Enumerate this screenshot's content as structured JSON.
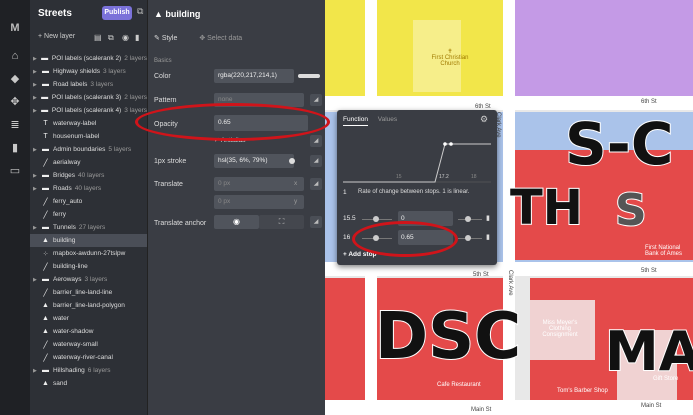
{
  "rail": [
    "M",
    "⌂",
    "◆",
    "✥",
    "≣",
    "▮",
    "▭"
  ],
  "layers_panel": {
    "title": "Streets",
    "publish": "Publish",
    "new_layer": "+ New layer",
    "items": [
      {
        "label": "POI labels (scalerank 2)",
        "count": "2 layers",
        "icon": "folder",
        "arrow": true
      },
      {
        "label": "Highway shields",
        "count": "3 layers",
        "icon": "folder",
        "arrow": true
      },
      {
        "label": "Road labels",
        "count": "3 layers",
        "icon": "folder",
        "arrow": true
      },
      {
        "label": "POI labels (scalerank 3)",
        "count": "2 layers",
        "icon": "folder",
        "arrow": true
      },
      {
        "label": "POI labels (scalerank 4)",
        "count": "3 layers",
        "icon": "folder",
        "arrow": true
      },
      {
        "label": "waterway-label",
        "count": "",
        "icon": "T",
        "arrow": false
      },
      {
        "label": "housenum-label",
        "count": "",
        "icon": "T",
        "arrow": false
      },
      {
        "label": "Admin boundaries",
        "count": "5 layers",
        "icon": "folder",
        "arrow": true
      },
      {
        "label": "aerialway",
        "count": "",
        "icon": "line",
        "arrow": false
      },
      {
        "label": "Bridges",
        "count": "40 layers",
        "icon": "folder",
        "arrow": true
      },
      {
        "label": "Roads",
        "count": "40 layers",
        "icon": "folder",
        "arrow": true
      },
      {
        "label": "ferry_auto",
        "count": "",
        "icon": "line",
        "arrow": false
      },
      {
        "label": "ferry",
        "count": "",
        "icon": "line",
        "arrow": false
      },
      {
        "label": "Tunnels",
        "count": "27 layers",
        "icon": "folder",
        "arrow": true
      },
      {
        "label": "building",
        "count": "",
        "icon": "fill",
        "arrow": false,
        "selected": true
      },
      {
        "label": "mapbox-awdunn-27tslpw",
        "count": "",
        "icon": "dots",
        "arrow": false
      },
      {
        "label": "building-line",
        "count": "",
        "icon": "line",
        "arrow": false
      },
      {
        "label": "Aeroways",
        "count": "3 layers",
        "icon": "folder",
        "arrow": true
      },
      {
        "label": "barrier_line-land-line",
        "count": "",
        "icon": "line",
        "arrow": false
      },
      {
        "label": "barrier_line-land-polygon",
        "count": "",
        "icon": "fill",
        "arrow": false
      },
      {
        "label": "water",
        "count": "",
        "icon": "fill",
        "arrow": false
      },
      {
        "label": "water-shadow",
        "count": "",
        "icon": "fill",
        "arrow": false
      },
      {
        "label": "waterway-small",
        "count": "",
        "icon": "line",
        "arrow": false
      },
      {
        "label": "waterway-river-canal",
        "count": "",
        "icon": "line",
        "arrow": false
      },
      {
        "label": "Hillshading",
        "count": "6 layers",
        "icon": "folder",
        "arrow": true
      },
      {
        "label": "sand",
        "count": "",
        "icon": "fill",
        "arrow": false
      }
    ]
  },
  "editor": {
    "layer_name": "building",
    "tab_style": "Style",
    "tab_select": "Select data",
    "section": "Basics",
    "color_label": "Color",
    "color_value": "rgba(220,217,214,1)",
    "pattern_label": "Pattern",
    "pattern_placeholder": "none",
    "opacity_label": "Opacity",
    "opacity_value": "0.65",
    "antialias_label": "Antialias",
    "stroke_label": "1px stroke",
    "stroke_value": "hsl(35, 6%, 79%)",
    "translate_label": "Translate",
    "translate_x_placeholder": "0 px",
    "translate_x_axis": "x",
    "translate_y_placeholder": "0 px",
    "translate_y_axis": "y",
    "anchor_label": "Translate anchor"
  },
  "popup": {
    "tab_function": "Function",
    "tab_values": "Values",
    "tick_left": "15",
    "tick_mid": "17.2",
    "tick_right": "18",
    "rate_value": "1",
    "rate_text": "Rate of change between stops. 1 is linear.",
    "stops": [
      {
        "zoom": "15.5",
        "value": "0"
      },
      {
        "zoom": "16",
        "value": "0.65"
      }
    ],
    "add_stop": "+ Add stop"
  },
  "map": {
    "labels": {
      "church": "First Christian Church",
      "sixth_a": "6th St",
      "sixth_b": "6th St",
      "clark_a": "Clark Ave",
      "clark_b": "Clark Ave",
      "fifth_a": "5th St",
      "fifth_b": "5th St",
      "bank": "First National Bank of Ames",
      "consign": "Miss Meyer's Clothing Consignment",
      "restaurant": "Cafe Restaurant",
      "barber": "Tom's Barber Shop",
      "store": "Gift Store",
      "main_a": "Main St",
      "main_b": "Main St"
    },
    "big": {
      "s": "S-C",
      "th": "TH",
      "st": "S",
      "dsc": "DSC",
      "ma": "MA"
    }
  }
}
